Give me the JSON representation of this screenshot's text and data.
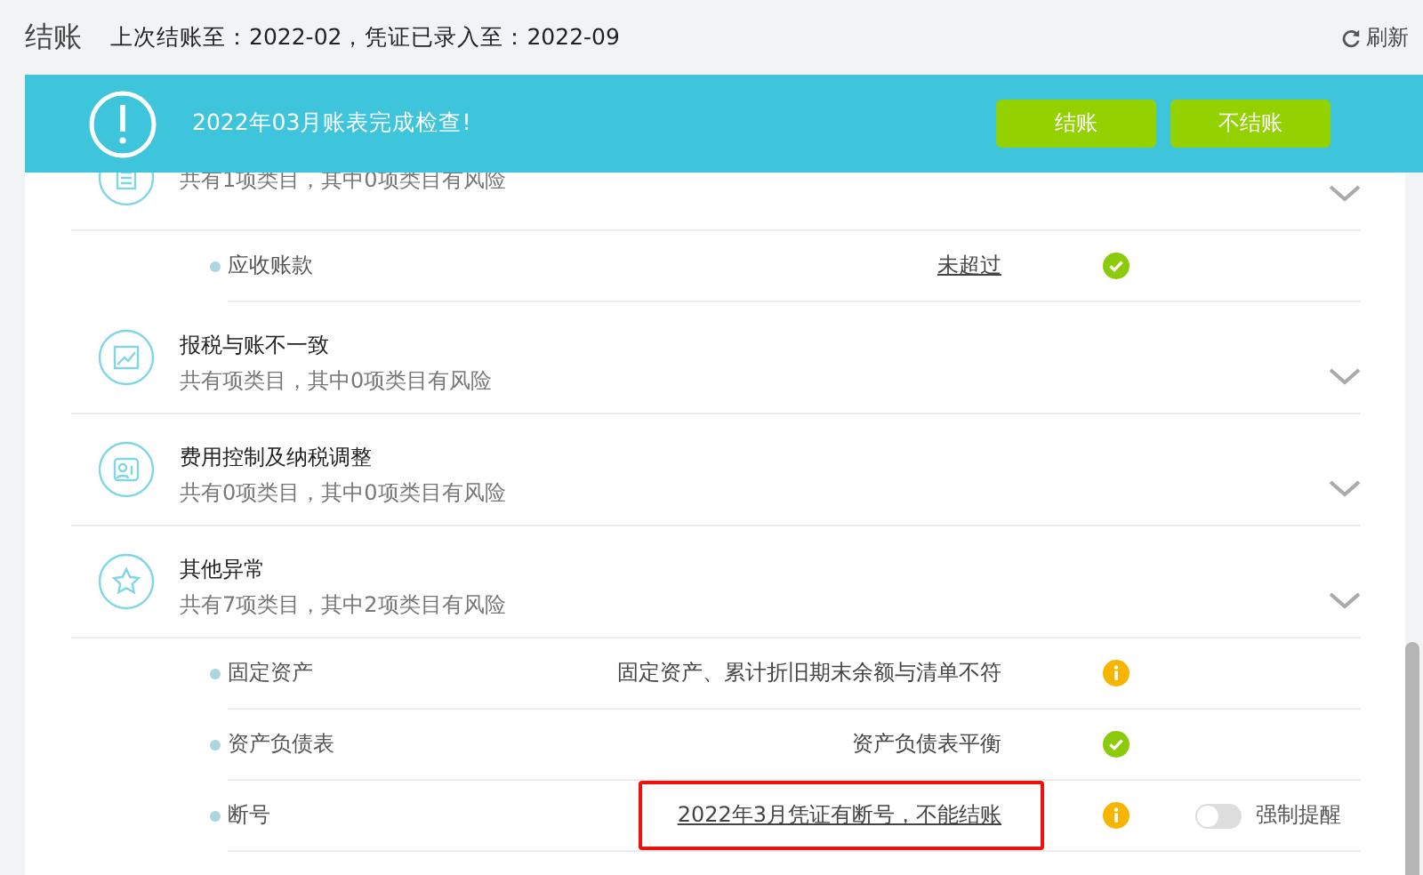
{
  "header": {
    "title": "结账",
    "info": "上次结账至：2022-02，凭证已录入至：2022-09",
    "refresh": "刷新"
  },
  "banner": {
    "message": "2022年03月账表完成检查!",
    "buttons": [
      "结账",
      "不结账"
    ]
  },
  "groups": [
    {
      "kind": "document",
      "subtitle": "共有1项类目，其中0项类目有风险",
      "items": [
        {
          "name": "应收账款",
          "result": "未超过",
          "link": true,
          "kind": "ok",
          "flagged": false
        }
      ]
    },
    {
      "kind": "chart",
      "title": "报税与账不一致",
      "subtitle": "共有项类目，其中0项类目有风险"
    },
    {
      "kind": "people",
      "title": "费用控制及纳税调整",
      "subtitle": "共有0项类目，其中0项类目有风险"
    },
    {
      "kind": "star",
      "title": "其他异常",
      "subtitle": "共有7项类目，其中2项类目有风险",
      "items": [
        {
          "name": "固定资产",
          "result": "固定资产、累计折旧期末余额与清单不符",
          "link": false,
          "kind": "warn",
          "flagged": false
        },
        {
          "name": "资产负债表",
          "result": "资产负债表平衡",
          "link": false,
          "kind": "ok",
          "flagged": false
        },
        {
          "name": "断号",
          "result": "2022年3月凭证有断号，不能结账",
          "link": true,
          "kind": "warn",
          "flagged": true,
          "toggle": {
            "label": "强制提醒",
            "on": false
          }
        }
      ]
    }
  ]
}
